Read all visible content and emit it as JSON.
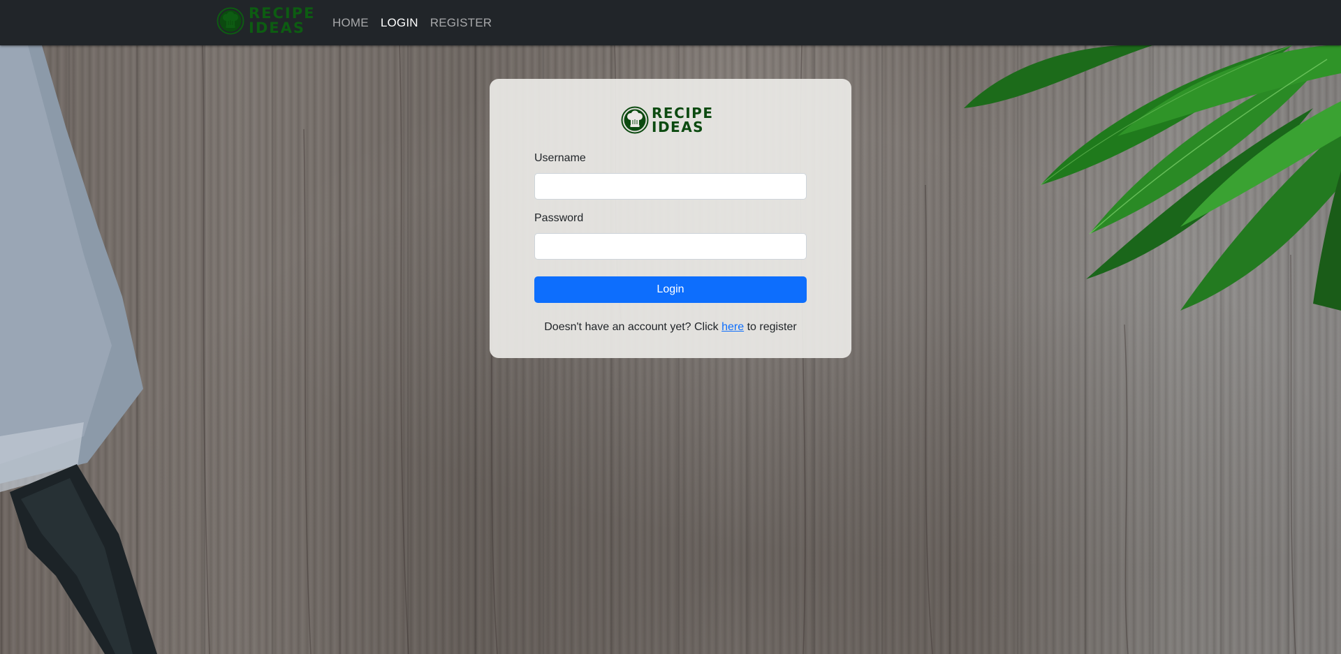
{
  "brand": {
    "line1": "RECIPE",
    "line2": "IDEAS",
    "icon": "chef-hat-icon",
    "color": "#0d5c12"
  },
  "nav": {
    "items": [
      {
        "label": "HOME",
        "active": false
      },
      {
        "label": "LOGIN",
        "active": true
      },
      {
        "label": "REGISTER",
        "active": false
      }
    ]
  },
  "login_form": {
    "logo_line1": "RECIPE",
    "logo_line2": "IDEAS",
    "username_label": "Username",
    "username_value": "",
    "password_label": "Password",
    "password_value": "",
    "submit_label": "Login",
    "register_prefix": "Doesn't have an account yet? Click ",
    "register_link": "here",
    "register_suffix": " to register"
  },
  "colors": {
    "navbar": "#212529",
    "primary": "#0d6efd",
    "brand_green": "#0d5c12"
  }
}
